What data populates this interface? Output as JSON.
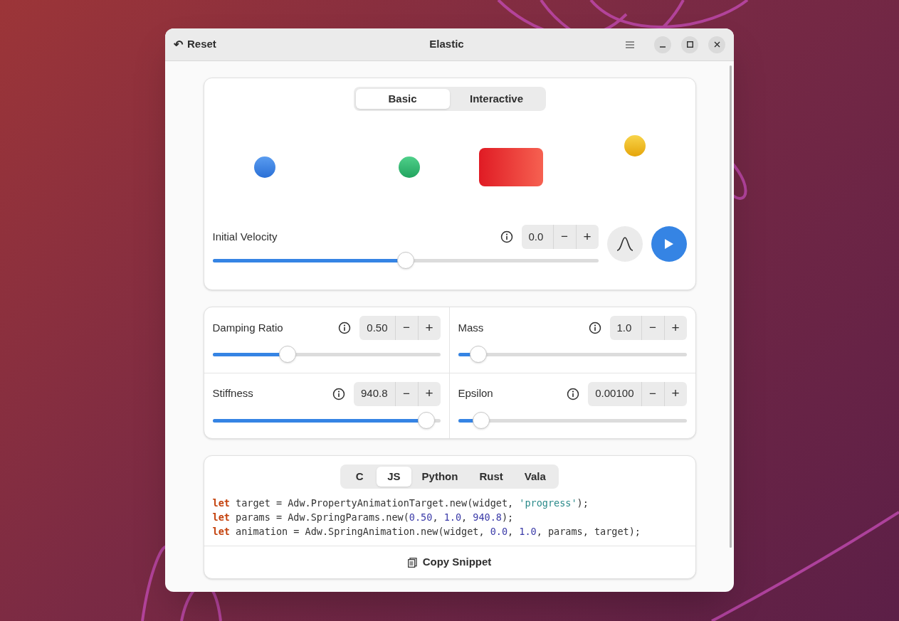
{
  "window": {
    "title": "Elastic",
    "reset_label": "Reset",
    "reset_icon": "↶"
  },
  "demo": {
    "tabs": [
      {
        "label": "Basic",
        "selected": true
      },
      {
        "label": "Interactive",
        "selected": false
      }
    ],
    "velocity": {
      "label": "Initial Velocity",
      "value": "0.0",
      "level": 0.5,
      "minus": "−",
      "plus": "+"
    }
  },
  "params": [
    {
      "label": "Damping Ratio",
      "value": "0.50",
      "level": 0.33,
      "minus": "−",
      "plus": "+"
    },
    {
      "label": "Mass",
      "value": "1.0",
      "level": 0.09,
      "minus": "−",
      "plus": "+"
    },
    {
      "label": "Stiffness",
      "value": "940.8",
      "level": 0.94,
      "minus": "−",
      "plus": "+"
    },
    {
      "label": "Epsilon",
      "value": "0.00100",
      "level": 0.1,
      "minus": "−",
      "plus": "+"
    }
  ],
  "code": {
    "tabs": [
      {
        "label": "C",
        "selected": false
      },
      {
        "label": "JS",
        "selected": true
      },
      {
        "label": "Python",
        "selected": false
      },
      {
        "label": "Rust",
        "selected": false
      },
      {
        "label": "Vala",
        "selected": false
      }
    ],
    "lines": [
      [
        {
          "kind": "keyword",
          "text": "let"
        },
        {
          "kind": "plain",
          "text": " target = Adw.PropertyAnimationTarget.new(widget, "
        },
        {
          "kind": "string",
          "text": "'progress'"
        },
        {
          "kind": "plain",
          "text": ");"
        }
      ],
      [
        {
          "kind": "keyword",
          "text": "let"
        },
        {
          "kind": "plain",
          "text": " params = Adw.SpringParams.new("
        },
        {
          "kind": "number",
          "text": "0.50"
        },
        {
          "kind": "plain",
          "text": ", "
        },
        {
          "kind": "number",
          "text": "1.0"
        },
        {
          "kind": "plain",
          "text": ", "
        },
        {
          "kind": "number",
          "text": "940.8"
        },
        {
          "kind": "plain",
          "text": ");"
        }
      ],
      [
        {
          "kind": "keyword",
          "text": "let"
        },
        {
          "kind": "plain",
          "text": " animation = Adw.SpringAnimation.new(widget, "
        },
        {
          "kind": "number",
          "text": "0.0"
        },
        {
          "kind": "plain",
          "text": ", "
        },
        {
          "kind": "number",
          "text": "1.0"
        },
        {
          "kind": "plain",
          "text": ", params, target);"
        }
      ]
    ],
    "copy_label": "Copy Snippet"
  }
}
